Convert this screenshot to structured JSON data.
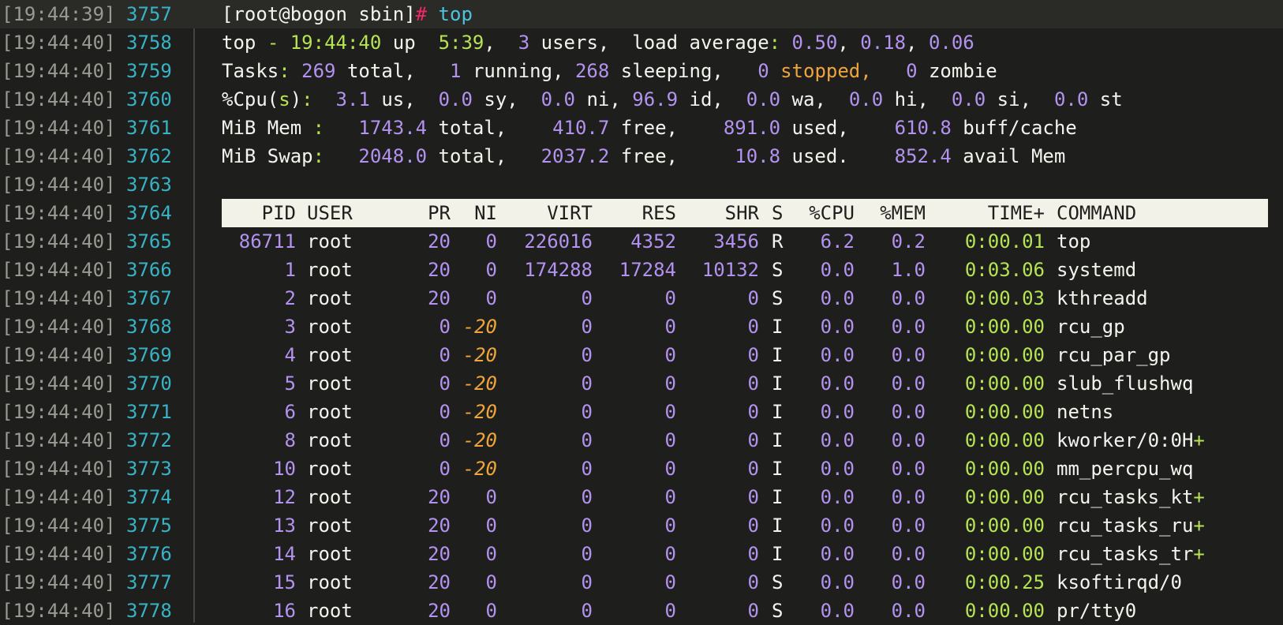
{
  "gutter": {
    "timestamps": [
      "[19:44:39]",
      "[19:44:40]",
      "[19:44:40]",
      "[19:44:40]",
      "[19:44:40]",
      "[19:44:40]",
      "[19:44:40]",
      "[19:44:40]",
      "[19:44:40]",
      "[19:44:40]",
      "[19:44:40]",
      "[19:44:40]",
      "[19:44:40]",
      "[19:44:40]",
      "[19:44:40]",
      "[19:44:40]",
      "[19:44:40]",
      "[19:44:40]",
      "[19:44:40]",
      "[19:44:40]",
      "[19:44:40]",
      "[19:44:40]"
    ],
    "line_numbers": [
      "3757",
      "3758",
      "3759",
      "3760",
      "3761",
      "3762",
      "3763",
      "3764",
      "3765",
      "3766",
      "3767",
      "3768",
      "3769",
      "3770",
      "3771",
      "3772",
      "3773",
      "3774",
      "3775",
      "3776",
      "3777",
      "3778"
    ]
  },
  "prompt": {
    "text": "[root@bogon sbin]",
    "symbol": "#",
    "command": "top"
  },
  "summary": {
    "uptime": {
      "prog": "top",
      "dash": "-",
      "time": "19:44:40",
      "up_label": "up",
      "up": "5:39",
      "users": "3",
      "users_label": "users,",
      "load_label": "load average",
      "load1": "0.50",
      "load5": "0.18",
      "load15": "0.06"
    },
    "tasks": {
      "label": "Tasks",
      "total": "269",
      "total_label": "total,",
      "running": "1",
      "running_label": "running,",
      "sleeping": "268",
      "sleeping_label": "sleeping,",
      "stopped": "0",
      "stopped_label": "stopped,",
      "zombie": "0",
      "zombie_label": "zombie"
    },
    "cpu": {
      "label_a": "%Cpu(",
      "label_s": "s",
      "label_b": ")",
      "us": "3.1",
      "sy": "0.0",
      "ni": "0.0",
      "id": "96.9",
      "wa": "0.0",
      "hi": "0.0",
      "si": "0.0",
      "st": "0.0"
    },
    "mem": {
      "label": "MiB Mem ",
      "total": "1743.4",
      "free": "410.7",
      "used": "891.0",
      "buff": "610.8"
    },
    "swap": {
      "label": "MiB Swap",
      "total": "2048.0",
      "free": "2037.2",
      "used": "10.8",
      "avail": "852.4"
    }
  },
  "table": {
    "headers": [
      "PID",
      "USER",
      "PR",
      "NI",
      "VIRT",
      "RES",
      "SHR",
      "S",
      "%CPU",
      "%MEM",
      "TIME+",
      "COMMAND"
    ],
    "rows": [
      {
        "pid": "86711",
        "user": "root",
        "pr": "20",
        "ni": "0",
        "virt": "226016",
        "res": "4352",
        "shr": "3456",
        "s": "R",
        "cpu": "6.2",
        "mem": "0.2",
        "time": "0:00.01",
        "cmd": "top"
      },
      {
        "pid": "1",
        "user": "root",
        "pr": "20",
        "ni": "0",
        "virt": "174288",
        "res": "17284",
        "shr": "10132",
        "s": "S",
        "cpu": "0.0",
        "mem": "1.0",
        "time": "0:03.06",
        "cmd": "systemd"
      },
      {
        "pid": "2",
        "user": "root",
        "pr": "20",
        "ni": "0",
        "virt": "0",
        "res": "0",
        "shr": "0",
        "s": "S",
        "cpu": "0.0",
        "mem": "0.0",
        "time": "0:00.03",
        "cmd": "kthreadd"
      },
      {
        "pid": "3",
        "user": "root",
        "pr": "0",
        "ni": "-20",
        "virt": "0",
        "res": "0",
        "shr": "0",
        "s": "I",
        "cpu": "0.0",
        "mem": "0.0",
        "time": "0:00.00",
        "cmd": "rcu_gp"
      },
      {
        "pid": "4",
        "user": "root",
        "pr": "0",
        "ni": "-20",
        "virt": "0",
        "res": "0",
        "shr": "0",
        "s": "I",
        "cpu": "0.0",
        "mem": "0.0",
        "time": "0:00.00",
        "cmd": "rcu_par_gp"
      },
      {
        "pid": "5",
        "user": "root",
        "pr": "0",
        "ni": "-20",
        "virt": "0",
        "res": "0",
        "shr": "0",
        "s": "I",
        "cpu": "0.0",
        "mem": "0.0",
        "time": "0:00.00",
        "cmd": "slub_flushwq"
      },
      {
        "pid": "6",
        "user": "root",
        "pr": "0",
        "ni": "-20",
        "virt": "0",
        "res": "0",
        "shr": "0",
        "s": "I",
        "cpu": "0.0",
        "mem": "0.0",
        "time": "0:00.00",
        "cmd": "netns"
      },
      {
        "pid": "8",
        "user": "root",
        "pr": "0",
        "ni": "-20",
        "virt": "0",
        "res": "0",
        "shr": "0",
        "s": "I",
        "cpu": "0.0",
        "mem": "0.0",
        "time": "0:00.00",
        "cmd": "kworker/0:0H+"
      },
      {
        "pid": "10",
        "user": "root",
        "pr": "0",
        "ni": "-20",
        "virt": "0",
        "res": "0",
        "shr": "0",
        "s": "I",
        "cpu": "0.0",
        "mem": "0.0",
        "time": "0:00.00",
        "cmd": "mm_percpu_wq"
      },
      {
        "pid": "12",
        "user": "root",
        "pr": "20",
        "ni": "0",
        "virt": "0",
        "res": "0",
        "shr": "0",
        "s": "I",
        "cpu": "0.0",
        "mem": "0.0",
        "time": "0:00.00",
        "cmd": "rcu_tasks_kt+"
      },
      {
        "pid": "13",
        "user": "root",
        "pr": "20",
        "ni": "0",
        "virt": "0",
        "res": "0",
        "shr": "0",
        "s": "I",
        "cpu": "0.0",
        "mem": "0.0",
        "time": "0:00.00",
        "cmd": "rcu_tasks_ru+"
      },
      {
        "pid": "14",
        "user": "root",
        "pr": "20",
        "ni": "0",
        "virt": "0",
        "res": "0",
        "shr": "0",
        "s": "I",
        "cpu": "0.0",
        "mem": "0.0",
        "time": "0:00.00",
        "cmd": "rcu_tasks_tr+"
      },
      {
        "pid": "15",
        "user": "root",
        "pr": "20",
        "ni": "0",
        "virt": "0",
        "res": "0",
        "shr": "0",
        "s": "S",
        "cpu": "0.0",
        "mem": "0.0",
        "time": "0:00.25",
        "cmd": "ksoftirqd/0"
      },
      {
        "pid": "16",
        "user": "root",
        "pr": "20",
        "ni": "0",
        "virt": "0",
        "res": "0",
        "shr": "0",
        "s": "S",
        "cpu": "0.0",
        "mem": "0.0",
        "time": "0:00.00",
        "cmd": "pr/tty0"
      }
    ]
  },
  "colors": {
    "background": "#1e1f1c",
    "text": "#f4f4ef",
    "green": "#b6e354",
    "purple": "#b392f0",
    "orange": "#f0a53c",
    "pink": "#f0286a",
    "cyan": "#4ec3e0",
    "line_number": "#38b3c6",
    "timestamp": "#9a9a93",
    "header_bar": "#f2f2e9"
  },
  "icons": {
    "fold": "fold-collapse-icon"
  }
}
